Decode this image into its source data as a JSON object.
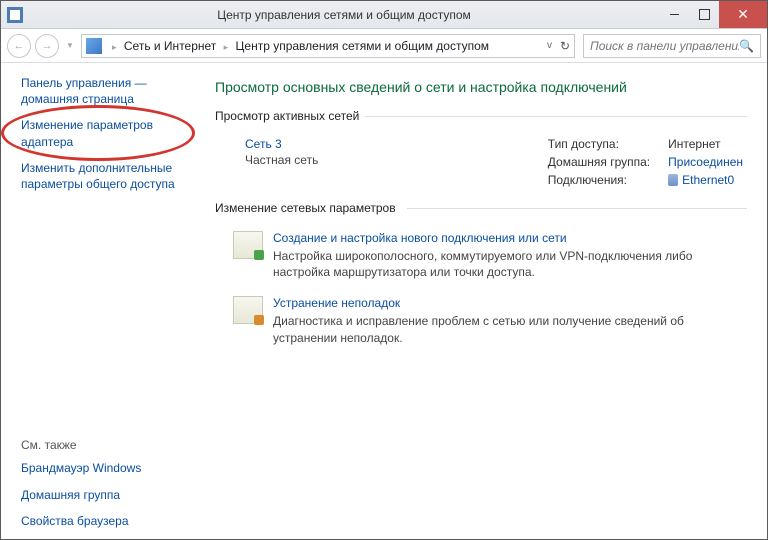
{
  "titlebar": {
    "title": "Центр управления сетями и общим доступом"
  },
  "toolbar": {
    "breadcrumb1": "Сеть и Интернет",
    "breadcrumb2": "Центр управления сетями и общим доступом",
    "search_placeholder": "Поиск в панели управления"
  },
  "sidebar": {
    "home1": "Панель управления —",
    "home2": "домашняя страница",
    "adapter": "Изменение параметров адаптера",
    "sharing": "Изменить дополнительные параметры общего доступа",
    "seealso": "См. также",
    "firewall": "Брандмауэр Windows",
    "homegroup": "Домашняя группа",
    "browser": "Свойства браузера"
  },
  "main": {
    "heading": "Просмотр основных сведений о сети и настройка подключений",
    "active_label": "Просмотр активных сетей",
    "net_name": "Сеть 3",
    "net_type": "Частная сеть",
    "access_label": "Тип доступа:",
    "access_value": "Интернет",
    "homegroup_label": "Домашняя группа:",
    "homegroup_value": "Присоединен",
    "conn_label": "Подключения:",
    "conn_value": "Ethernet0",
    "change_label": "Изменение сетевых параметров",
    "item1_title": "Создание и настройка нового подключения или сети",
    "item1_desc": "Настройка широкополосного, коммутируемого или VPN-подключения либо настройка маршрутизатора или точки доступа.",
    "item2_title": "Устранение неполадок",
    "item2_desc": "Диагностика и исправление проблем с сетью или получение сведений об устранении неполадок."
  }
}
